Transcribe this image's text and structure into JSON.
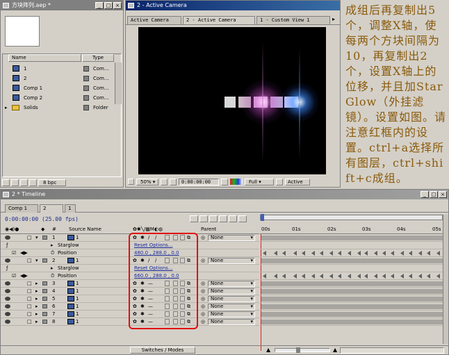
{
  "project": {
    "title": "方块阵列.aep *",
    "columns": {
      "name": "Name",
      "type": "Type"
    },
    "items": [
      {
        "name": "1",
        "type": "Com...",
        "kind": "comp"
      },
      {
        "name": "2",
        "type": "Com...",
        "kind": "comp"
      },
      {
        "name": "Comp 1",
        "type": "Com...",
        "kind": "comp"
      },
      {
        "name": "Comp 2",
        "type": "Com...",
        "kind": "comp"
      },
      {
        "name": "Solids",
        "type": "Folder",
        "kind": "folder"
      }
    ],
    "bpc": "8 bpc"
  },
  "viewer": {
    "title": "2 - Active Camera",
    "tabs": [
      "Active Camera",
      "2 - Active Camera",
      "1 - Custom View 1"
    ],
    "zoom": "50%",
    "timecode": "0:00:00:00",
    "resolution": "Full",
    "camera": "Active"
  },
  "instructions": "成组后再复制出5个，调整X轴，使每两个方块间隔为10，再复制出2个，设置X轴上的位移，并且加StarGlow（外挂滤镜）。设置如图。请注意红框内的设置。ctrl+a选择所有图层，ctrl+shift+c成组。",
  "timeline": {
    "title": "2 * Timeline",
    "tabs": [
      "Comp 1",
      "2",
      "1"
    ],
    "timecode": "0:00:00:00",
    "fps": "(25.00 fps)",
    "header": {
      "source_name": "Source Name",
      "parent": "Parent"
    },
    "ruler": [
      "00s",
      "01s",
      "02s",
      "03s",
      "04s",
      "05s"
    ],
    "switches_label": "Switches / Modes",
    "layers": [
      {
        "num": "1",
        "name": "1",
        "parent": "None",
        "expanded": true,
        "effect": "Starglow",
        "effect_value": "Reset Options...",
        "position": "480.0 , 288.0 , 0.0"
      },
      {
        "num": "2",
        "name": "1",
        "parent": "None",
        "expanded": true,
        "effect": "Starglow",
        "effect_value": "Reset Options...",
        "position": "660.0 , 288.0 , 0.0"
      },
      {
        "num": "3",
        "name": "1",
        "parent": "None"
      },
      {
        "num": "4",
        "name": "1",
        "parent": "None"
      },
      {
        "num": "5",
        "name": "1",
        "parent": "None"
      },
      {
        "num": "6",
        "name": "1",
        "parent": "None"
      },
      {
        "num": "7",
        "name": "1",
        "parent": "None"
      },
      {
        "num": "8",
        "name": "1",
        "parent": "None"
      }
    ],
    "position_label": "Position"
  }
}
